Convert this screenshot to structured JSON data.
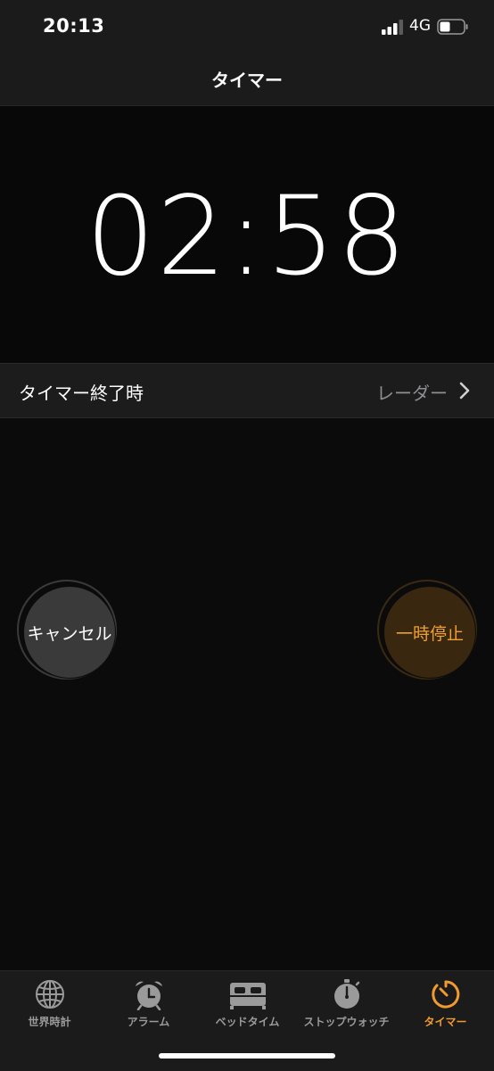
{
  "status_bar": {
    "time": "20:13",
    "network": "4G"
  },
  "nav": {
    "title": "タイマー"
  },
  "timer": {
    "remaining": "02:58"
  },
  "sound_row": {
    "label": "タイマー終了時",
    "value": "レーダー"
  },
  "buttons": {
    "cancel": "キャンセル",
    "pause": "一時停止"
  },
  "tabs": [
    {
      "label": "世界時計",
      "icon": "globe-icon"
    },
    {
      "label": "アラーム",
      "icon": "alarm-clock-icon"
    },
    {
      "label": "ベッドタイム",
      "icon": "bed-icon"
    },
    {
      "label": "ストップウォッチ",
      "icon": "stopwatch-icon"
    },
    {
      "label": "タイマー",
      "icon": "timer-icon"
    }
  ],
  "active_tab": "タイマー",
  "colors": {
    "accent": "#f09a2f",
    "inactive": "#9a9a9a",
    "background": "#0b0b0b"
  }
}
